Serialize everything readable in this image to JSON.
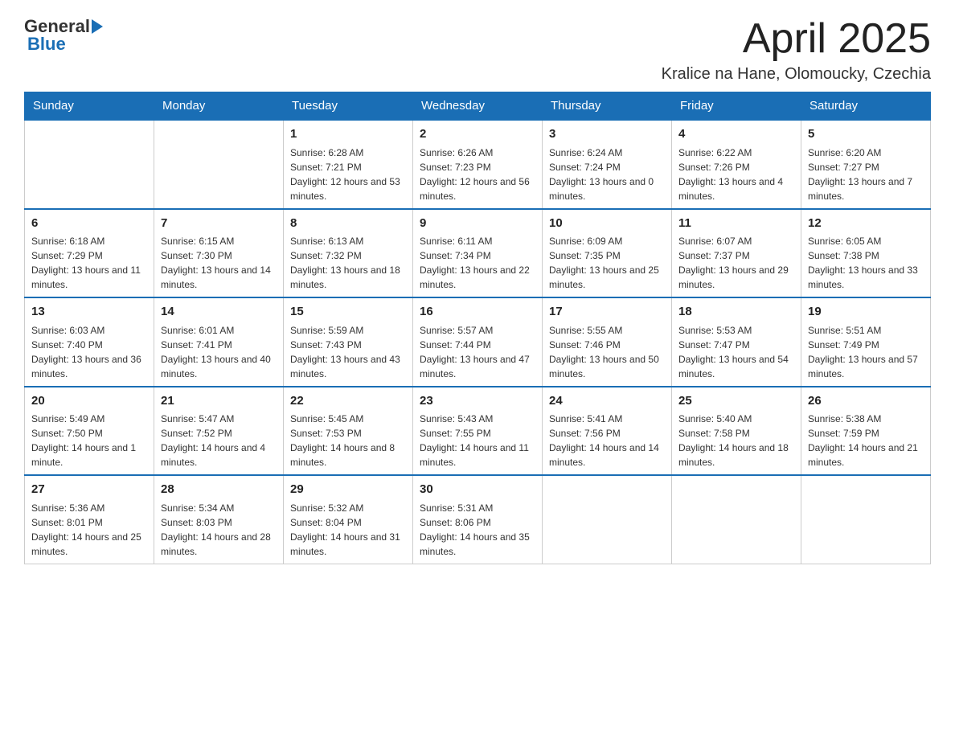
{
  "header": {
    "logo_general": "General",
    "logo_blue": "Blue",
    "month_title": "April 2025",
    "subtitle": "Kralice na Hane, Olomoucky, Czechia"
  },
  "days_of_week": [
    "Sunday",
    "Monday",
    "Tuesday",
    "Wednesday",
    "Thursday",
    "Friday",
    "Saturday"
  ],
  "weeks": [
    [
      {
        "day": "",
        "sunrise": "",
        "sunset": "",
        "daylight": ""
      },
      {
        "day": "",
        "sunrise": "",
        "sunset": "",
        "daylight": ""
      },
      {
        "day": "1",
        "sunrise": "Sunrise: 6:28 AM",
        "sunset": "Sunset: 7:21 PM",
        "daylight": "Daylight: 12 hours and 53 minutes."
      },
      {
        "day": "2",
        "sunrise": "Sunrise: 6:26 AM",
        "sunset": "Sunset: 7:23 PM",
        "daylight": "Daylight: 12 hours and 56 minutes."
      },
      {
        "day": "3",
        "sunrise": "Sunrise: 6:24 AM",
        "sunset": "Sunset: 7:24 PM",
        "daylight": "Daylight: 13 hours and 0 minutes."
      },
      {
        "day": "4",
        "sunrise": "Sunrise: 6:22 AM",
        "sunset": "Sunset: 7:26 PM",
        "daylight": "Daylight: 13 hours and 4 minutes."
      },
      {
        "day": "5",
        "sunrise": "Sunrise: 6:20 AM",
        "sunset": "Sunset: 7:27 PM",
        "daylight": "Daylight: 13 hours and 7 minutes."
      }
    ],
    [
      {
        "day": "6",
        "sunrise": "Sunrise: 6:18 AM",
        "sunset": "Sunset: 7:29 PM",
        "daylight": "Daylight: 13 hours and 11 minutes."
      },
      {
        "day": "7",
        "sunrise": "Sunrise: 6:15 AM",
        "sunset": "Sunset: 7:30 PM",
        "daylight": "Daylight: 13 hours and 14 minutes."
      },
      {
        "day": "8",
        "sunrise": "Sunrise: 6:13 AM",
        "sunset": "Sunset: 7:32 PM",
        "daylight": "Daylight: 13 hours and 18 minutes."
      },
      {
        "day": "9",
        "sunrise": "Sunrise: 6:11 AM",
        "sunset": "Sunset: 7:34 PM",
        "daylight": "Daylight: 13 hours and 22 minutes."
      },
      {
        "day": "10",
        "sunrise": "Sunrise: 6:09 AM",
        "sunset": "Sunset: 7:35 PM",
        "daylight": "Daylight: 13 hours and 25 minutes."
      },
      {
        "day": "11",
        "sunrise": "Sunrise: 6:07 AM",
        "sunset": "Sunset: 7:37 PM",
        "daylight": "Daylight: 13 hours and 29 minutes."
      },
      {
        "day": "12",
        "sunrise": "Sunrise: 6:05 AM",
        "sunset": "Sunset: 7:38 PM",
        "daylight": "Daylight: 13 hours and 33 minutes."
      }
    ],
    [
      {
        "day": "13",
        "sunrise": "Sunrise: 6:03 AM",
        "sunset": "Sunset: 7:40 PM",
        "daylight": "Daylight: 13 hours and 36 minutes."
      },
      {
        "day": "14",
        "sunrise": "Sunrise: 6:01 AM",
        "sunset": "Sunset: 7:41 PM",
        "daylight": "Daylight: 13 hours and 40 minutes."
      },
      {
        "day": "15",
        "sunrise": "Sunrise: 5:59 AM",
        "sunset": "Sunset: 7:43 PM",
        "daylight": "Daylight: 13 hours and 43 minutes."
      },
      {
        "day": "16",
        "sunrise": "Sunrise: 5:57 AM",
        "sunset": "Sunset: 7:44 PM",
        "daylight": "Daylight: 13 hours and 47 minutes."
      },
      {
        "day": "17",
        "sunrise": "Sunrise: 5:55 AM",
        "sunset": "Sunset: 7:46 PM",
        "daylight": "Daylight: 13 hours and 50 minutes."
      },
      {
        "day": "18",
        "sunrise": "Sunrise: 5:53 AM",
        "sunset": "Sunset: 7:47 PM",
        "daylight": "Daylight: 13 hours and 54 minutes."
      },
      {
        "day": "19",
        "sunrise": "Sunrise: 5:51 AM",
        "sunset": "Sunset: 7:49 PM",
        "daylight": "Daylight: 13 hours and 57 minutes."
      }
    ],
    [
      {
        "day": "20",
        "sunrise": "Sunrise: 5:49 AM",
        "sunset": "Sunset: 7:50 PM",
        "daylight": "Daylight: 14 hours and 1 minute."
      },
      {
        "day": "21",
        "sunrise": "Sunrise: 5:47 AM",
        "sunset": "Sunset: 7:52 PM",
        "daylight": "Daylight: 14 hours and 4 minutes."
      },
      {
        "day": "22",
        "sunrise": "Sunrise: 5:45 AM",
        "sunset": "Sunset: 7:53 PM",
        "daylight": "Daylight: 14 hours and 8 minutes."
      },
      {
        "day": "23",
        "sunrise": "Sunrise: 5:43 AM",
        "sunset": "Sunset: 7:55 PM",
        "daylight": "Daylight: 14 hours and 11 minutes."
      },
      {
        "day": "24",
        "sunrise": "Sunrise: 5:41 AM",
        "sunset": "Sunset: 7:56 PM",
        "daylight": "Daylight: 14 hours and 14 minutes."
      },
      {
        "day": "25",
        "sunrise": "Sunrise: 5:40 AM",
        "sunset": "Sunset: 7:58 PM",
        "daylight": "Daylight: 14 hours and 18 minutes."
      },
      {
        "day": "26",
        "sunrise": "Sunrise: 5:38 AM",
        "sunset": "Sunset: 7:59 PM",
        "daylight": "Daylight: 14 hours and 21 minutes."
      }
    ],
    [
      {
        "day": "27",
        "sunrise": "Sunrise: 5:36 AM",
        "sunset": "Sunset: 8:01 PM",
        "daylight": "Daylight: 14 hours and 25 minutes."
      },
      {
        "day": "28",
        "sunrise": "Sunrise: 5:34 AM",
        "sunset": "Sunset: 8:03 PM",
        "daylight": "Daylight: 14 hours and 28 minutes."
      },
      {
        "day": "29",
        "sunrise": "Sunrise: 5:32 AM",
        "sunset": "Sunset: 8:04 PM",
        "daylight": "Daylight: 14 hours and 31 minutes."
      },
      {
        "day": "30",
        "sunrise": "Sunrise: 5:31 AM",
        "sunset": "Sunset: 8:06 PM",
        "daylight": "Daylight: 14 hours and 35 minutes."
      },
      {
        "day": "",
        "sunrise": "",
        "sunset": "",
        "daylight": ""
      },
      {
        "day": "",
        "sunrise": "",
        "sunset": "",
        "daylight": ""
      },
      {
        "day": "",
        "sunrise": "",
        "sunset": "",
        "daylight": ""
      }
    ]
  ]
}
